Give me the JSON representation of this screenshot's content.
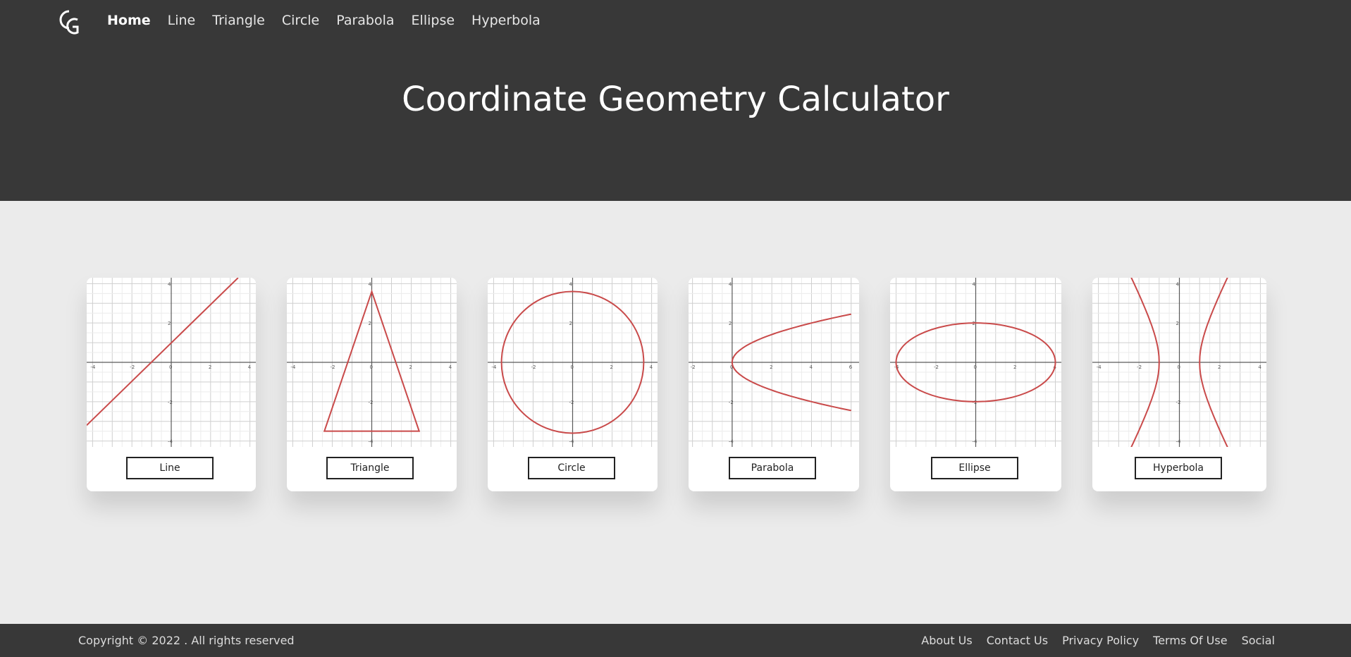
{
  "nav": {
    "logo_icon": "cg-logo-icon",
    "items": [
      {
        "label": "Home",
        "active": true
      },
      {
        "label": "Line"
      },
      {
        "label": "Triangle"
      },
      {
        "label": "Circle"
      },
      {
        "label": "Parabola"
      },
      {
        "label": "Ellipse"
      },
      {
        "label": "Hyperbola"
      }
    ]
  },
  "hero": {
    "title": "Coordinate Geometry Calculator"
  },
  "cards": [
    {
      "label": "Line",
      "shape": "line",
      "x_ticks": [
        "-4",
        "-2",
        "0",
        "2",
        "4"
      ],
      "y_ticks": [
        "4",
        "2",
        "-2",
        "-4"
      ]
    },
    {
      "label": "Triangle",
      "shape": "triangle",
      "x_ticks": [
        "-4",
        "-2",
        "0",
        "2",
        "4"
      ],
      "y_ticks": [
        "4",
        "2",
        "-2",
        "-4"
      ]
    },
    {
      "label": "Circle",
      "shape": "circle",
      "x_ticks": [
        "-4",
        "-2",
        "0",
        "2",
        "4"
      ],
      "y_ticks": [
        "4",
        "2",
        "-2",
        "-4"
      ]
    },
    {
      "label": "Parabola",
      "shape": "parabola",
      "x_ticks": [
        "-2",
        "0",
        "2",
        "4",
        "6"
      ],
      "y_ticks": [
        "4",
        "2",
        "-2",
        "-4"
      ]
    },
    {
      "label": "Ellipse",
      "shape": "ellipse",
      "x_ticks": [
        "-4",
        "-2",
        "0",
        "2",
        "4"
      ],
      "y_ticks": [
        "4",
        "2",
        "-2",
        "-4"
      ]
    },
    {
      "label": "Hyperbola",
      "shape": "hyperbola",
      "x_ticks": [
        "-4",
        "-2",
        "0",
        "2",
        "4"
      ],
      "y_ticks": [
        "4",
        "2",
        "-2",
        "-4"
      ]
    }
  ],
  "footer": {
    "copyright": "Copyright © 2022 . All rights reserved",
    "links": [
      "About Us",
      "Contact Us",
      "Privacy Policy",
      "Terms Of Use",
      "Social"
    ]
  },
  "colors": {
    "header_bg": "#383838",
    "page_bg": "#ebebeb",
    "curve": "#c94a4a",
    "line_curve": "#e0a0a0"
  }
}
